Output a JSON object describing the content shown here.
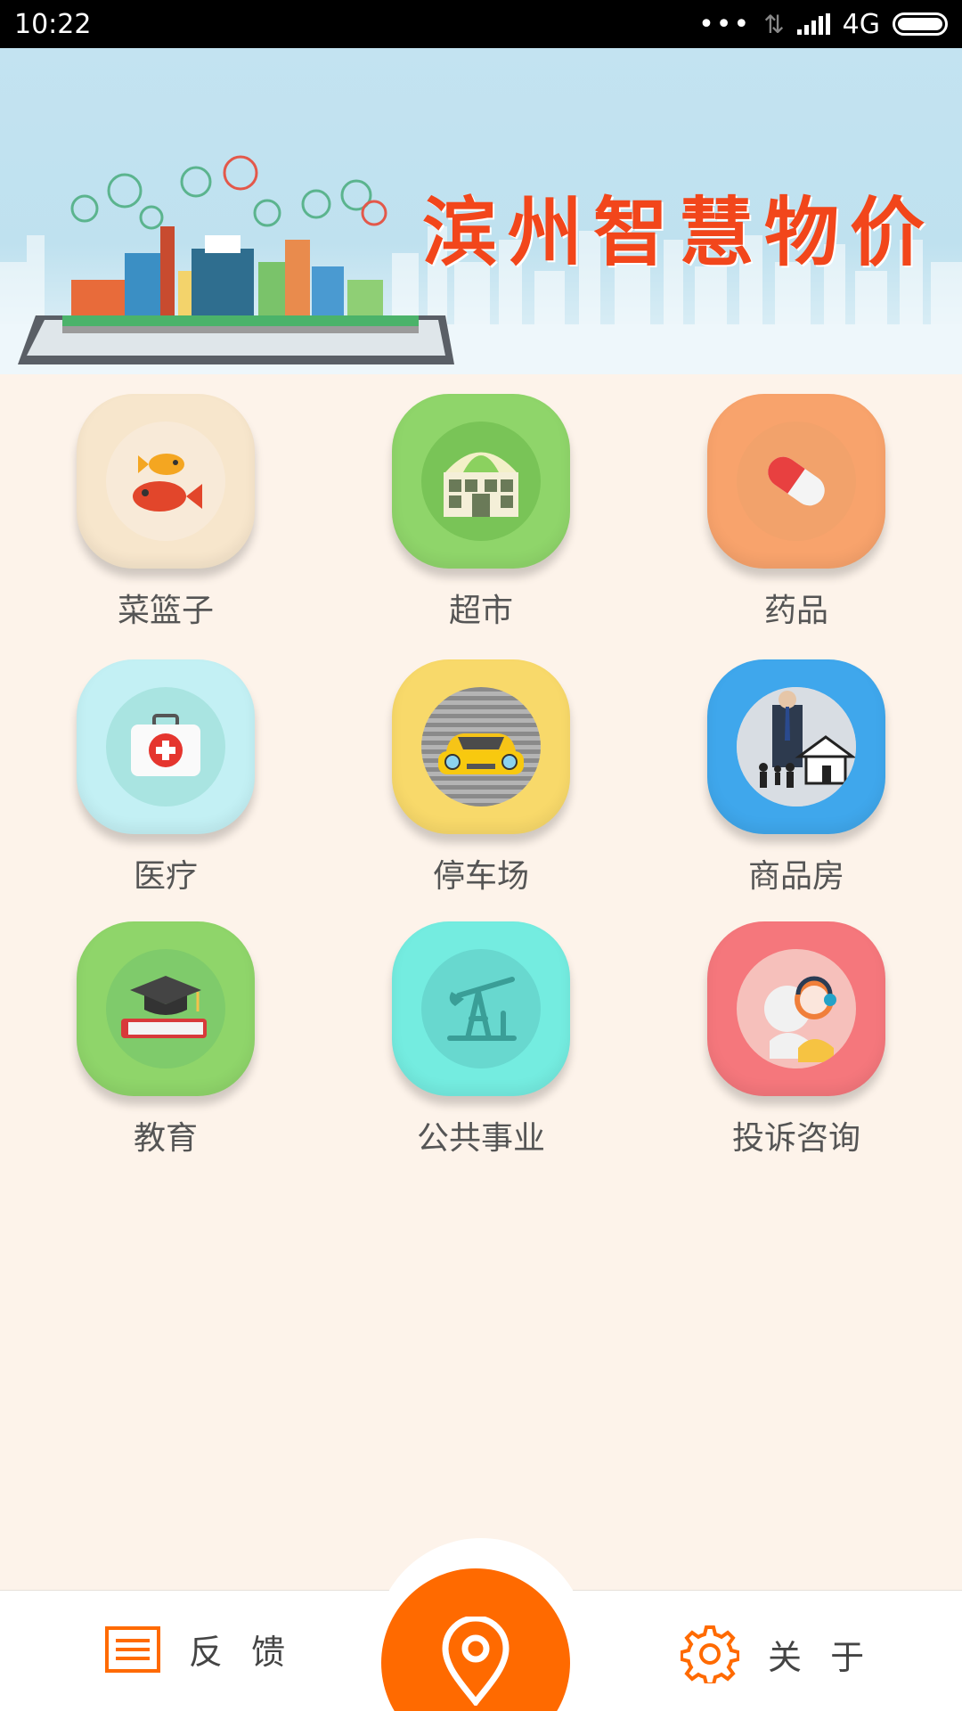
{
  "status_bar": {
    "time": "10:22",
    "network": "4G",
    "icons": [
      "more-dots-icon",
      "data-transfer-icon",
      "signal-icon",
      "battery-icon"
    ]
  },
  "banner": {
    "title": "滨州智慧物价"
  },
  "grid": [
    {
      "label": "菜篮子",
      "icon": "fish-icon"
    },
    {
      "label": "超市",
      "icon": "supermarket-icon"
    },
    {
      "label": "药品",
      "icon": "pill-icon"
    },
    {
      "label": "医疗",
      "icon": "medical-kit-icon"
    },
    {
      "label": "停车场",
      "icon": "car-icon"
    },
    {
      "label": "商品房",
      "icon": "house-businessman-icon"
    },
    {
      "label": "教育",
      "icon": "graduation-book-icon"
    },
    {
      "label": "公共事业",
      "icon": "oil-pump-icon"
    },
    {
      "label": "投诉咨询",
      "icon": "headset-support-icon"
    }
  ],
  "colors": {
    "accent": "#ff6a00",
    "background": "#fdf3ea",
    "banner_title": "#f2461b"
  },
  "bottom_nav": {
    "feedback_label": "反 馈",
    "about_label": "关 于",
    "center_icon": "location-pin-icon"
  }
}
